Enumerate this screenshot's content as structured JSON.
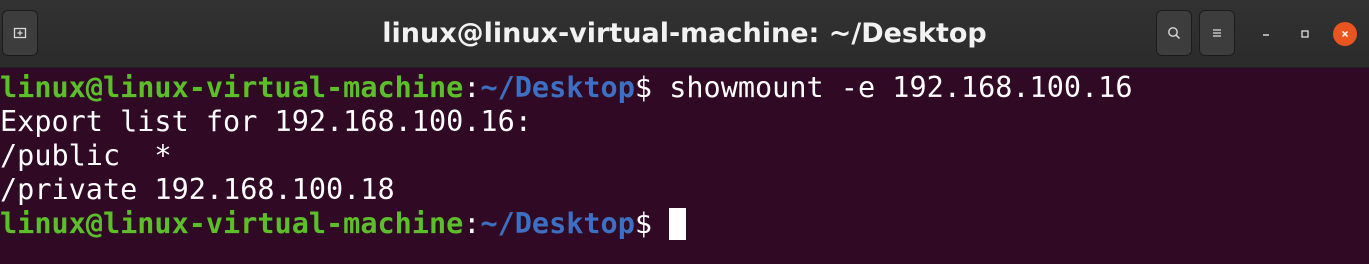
{
  "window": {
    "title": "linux@linux-virtual-machine: ~/Desktop"
  },
  "icons": {
    "new_tab": "new-tab-icon",
    "search": "search-icon",
    "menu": "hamburger-menu-icon",
    "minimize": "minimize-icon",
    "maximize": "maximize-icon",
    "close": "close-icon"
  },
  "colors": {
    "terminal_background": "#300a24",
    "prompt_user": "#5bbf2a",
    "prompt_path": "#3d6fc2",
    "text": "#ffffff",
    "close_button": "#e95420"
  },
  "terminal": {
    "line1": {
      "user": "linux@linux-virtual-machine",
      "separator": ":",
      "path": "~/Desktop",
      "prompt_symbol": "$",
      "command": " showmount -e 192.168.100.16"
    },
    "line2": "Export list for 192.168.100.16:",
    "line3": "/public  *",
    "line4": "/private 192.168.100.18",
    "line5": {
      "user": "linux@linux-virtual-machine",
      "separator": ":",
      "path": "~/Desktop",
      "prompt_symbol": "$"
    }
  }
}
